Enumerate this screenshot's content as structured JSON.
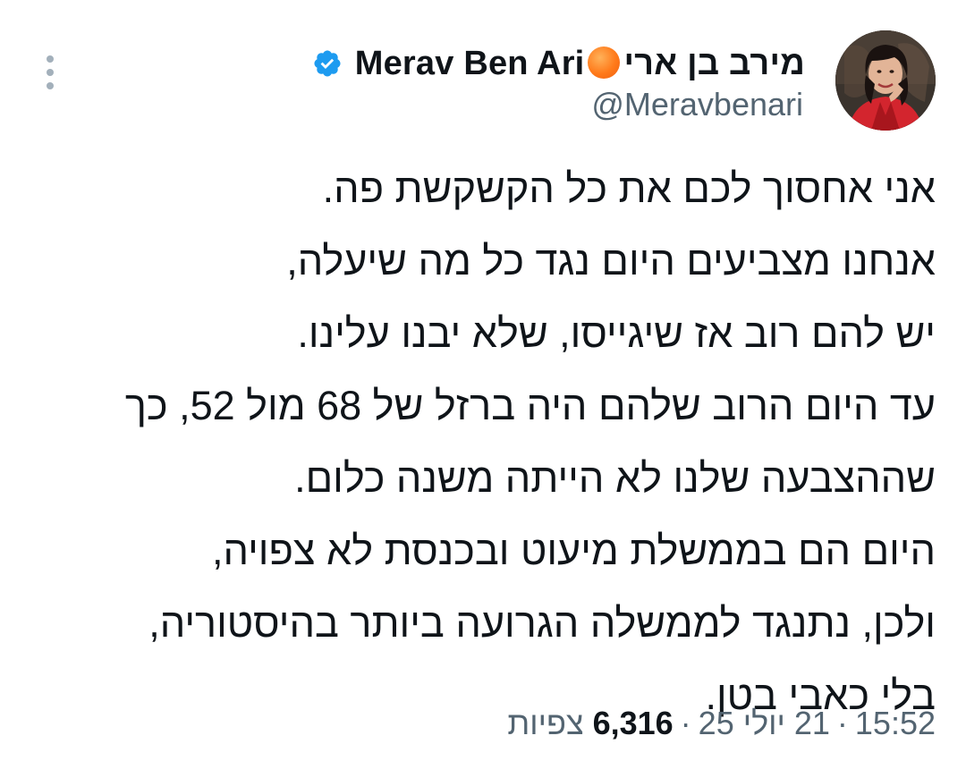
{
  "author": {
    "display_name_he": "מירב בן ארי",
    "display_name_en": "Merav Ben Ari",
    "handle": "@Meravbenari",
    "verified": true,
    "verified_color": "#1d9bf0",
    "emoji": "orange-circle"
  },
  "tweet": {
    "lines": [
      "אני אחסוך לכם את כל הקשקשת פה.",
      "אנחנו מצביעים היום נגד כל מה שיעלה,",
      "יש להם רוב אז שיגייסו, שלא יבנו עלינו.",
      "עד היום הרוב שלהם היה ברזל של 68 מול 52, כך",
      "שההצבעה שלנו לא הייתה משנה כלום.",
      "היום הם בממשלת מיעוט ובכנסת לא צפויה,",
      "ולכן, נתנגד לממשלה הגרועה ביותר בהיסטוריה,",
      "בלי כאבי בטן."
    ]
  },
  "meta": {
    "time": "15:52",
    "date": "21 יולי 25",
    "views_count": "6,316",
    "views_label": "צפיות",
    "separator": "·"
  },
  "icons": {
    "menu": "more-vertical-icon",
    "verified": "verified-badge-icon"
  }
}
